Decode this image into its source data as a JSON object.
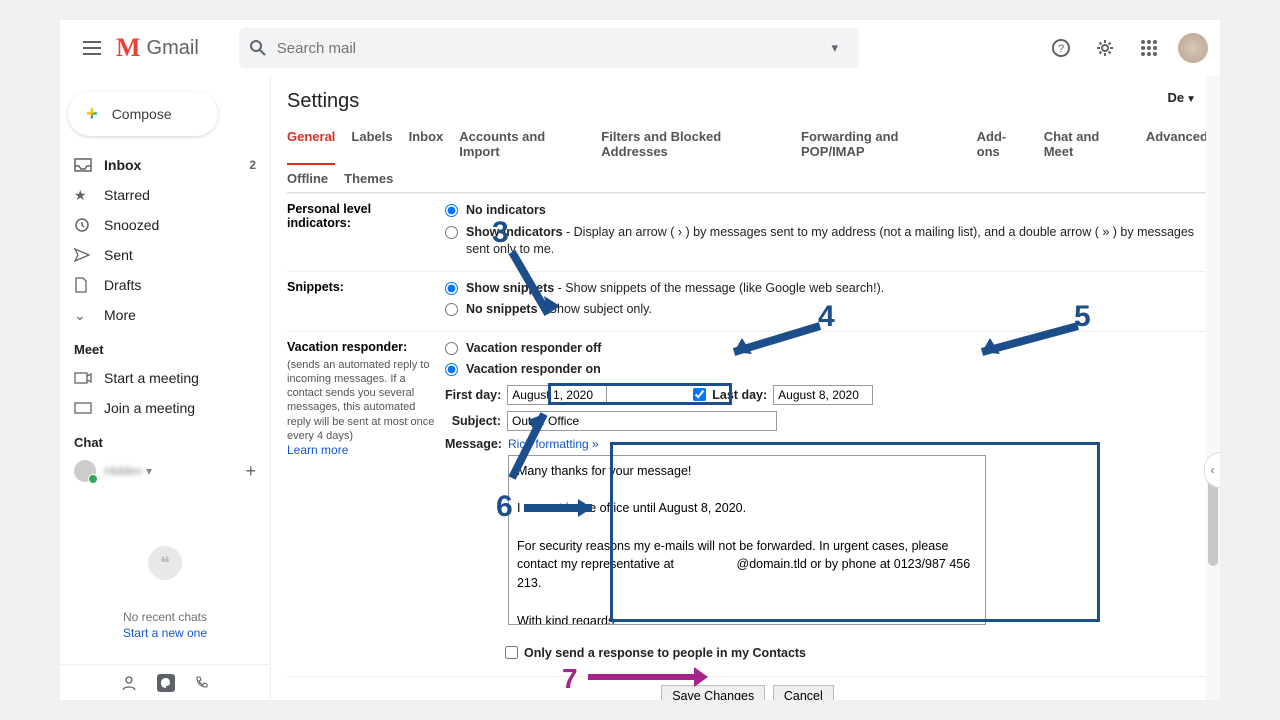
{
  "header": {
    "app_name": "Gmail",
    "search_placeholder": "Search mail"
  },
  "sidebar": {
    "compose_label": "Compose",
    "items": [
      {
        "label": "Inbox",
        "count": "2"
      },
      {
        "label": "Starred"
      },
      {
        "label": "Snoozed"
      },
      {
        "label": "Sent"
      },
      {
        "label": "Drafts"
      },
      {
        "label": "More"
      }
    ],
    "meet_header": "Meet",
    "meet_items": [
      {
        "label": "Start a meeting"
      },
      {
        "label": "Join a meeting"
      }
    ],
    "chat_header": "Chat",
    "chat_user": "Hidden",
    "hangouts_empty": "No recent chats",
    "hangouts_link": "Start a new one"
  },
  "settings": {
    "title": "Settings",
    "language_short": "De",
    "tabs_row1": [
      "General",
      "Labels",
      "Inbox",
      "Accounts and Import",
      "Filters and Blocked Addresses",
      "Forwarding and POP/IMAP",
      "Add-ons",
      "Chat and Meet",
      "Advanced"
    ],
    "tabs_row2": [
      "Offline",
      "Themes"
    ],
    "personal_level": {
      "label": "Personal level indicators:",
      "opt1_bold": "No indicators",
      "opt2_bold": "Show indicators",
      "opt2_rest": " - Display an arrow ( › ) by messages sent to my address (not a mailing list), and a double arrow ( » ) by messages sent only to me."
    },
    "snippets": {
      "label": "Snippets:",
      "opt1_bold": "Show snippets",
      "opt1_rest": " - Show snippets of the message (like Google web search!).",
      "opt2_bold": "No snippets",
      "opt2_rest": " - Show subject only."
    },
    "vacation": {
      "label": "Vacation responder:",
      "help": "(sends an automated reply to incoming messages. If a contact sends you several messages, this automated reply will be sent at most once every 4 days)",
      "learn_more": "Learn more",
      "off_label": "Vacation responder off",
      "on_label": "Vacation responder on",
      "first_day_label": "First day:",
      "first_day_value": "August 1, 2020",
      "last_day_label": "Last day:",
      "last_day_value": "August 8, 2020",
      "subject_label": "Subject:",
      "subject_value": "Out of Office",
      "message_label": "Message:",
      "rich_formatting": "Rich formatting »",
      "message_body": "Many thanks for your message!\n\nI am not in the office until August 8, 2020.\n\nFor security reasons my e-mails will not be forwarded. In urgent cases, please contact my representative at                  @domain.tld or by phone at 0123/987 456 213.\n\nWith kind regards\n\nMax Mustermeier\n\nSales Manager",
      "only_contacts": "Only send a response to people in my Contacts"
    },
    "save_label": "Save Changes",
    "cancel_label": "Cancel"
  },
  "annotations": {
    "n3": "3",
    "n4": "4",
    "n5": "5",
    "n6": "6",
    "n7": "7"
  }
}
